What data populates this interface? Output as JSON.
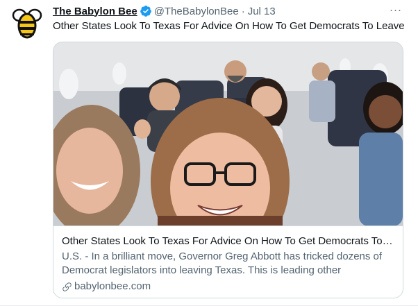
{
  "tweet": {
    "author_name": "The Babylon Bee",
    "handle": "@TheBabylonBee",
    "separator": "·",
    "date": "Jul 13",
    "more_label": "···",
    "text": "Other States Look To Texas For Advice On How To Get Democrats To Leave"
  },
  "card": {
    "title": "Other States Look To Texas For Advice On How To Get Democrats To Le...",
    "description": "U.S. - In a brilliant move, Governor Greg Abbott has tricked dozens of Democrat legislators into leaving Texas. This is leading other governors...",
    "domain": "babylonbee.com"
  },
  "colors": {
    "verified": "#1d9bf0",
    "secondary_text": "#536471",
    "bee_yellow": "#f5c518"
  },
  "icons": {
    "avatar": "bee-logo-icon",
    "verified": "verified-badge-icon",
    "link": "link-icon",
    "more": "more-options-icon"
  }
}
